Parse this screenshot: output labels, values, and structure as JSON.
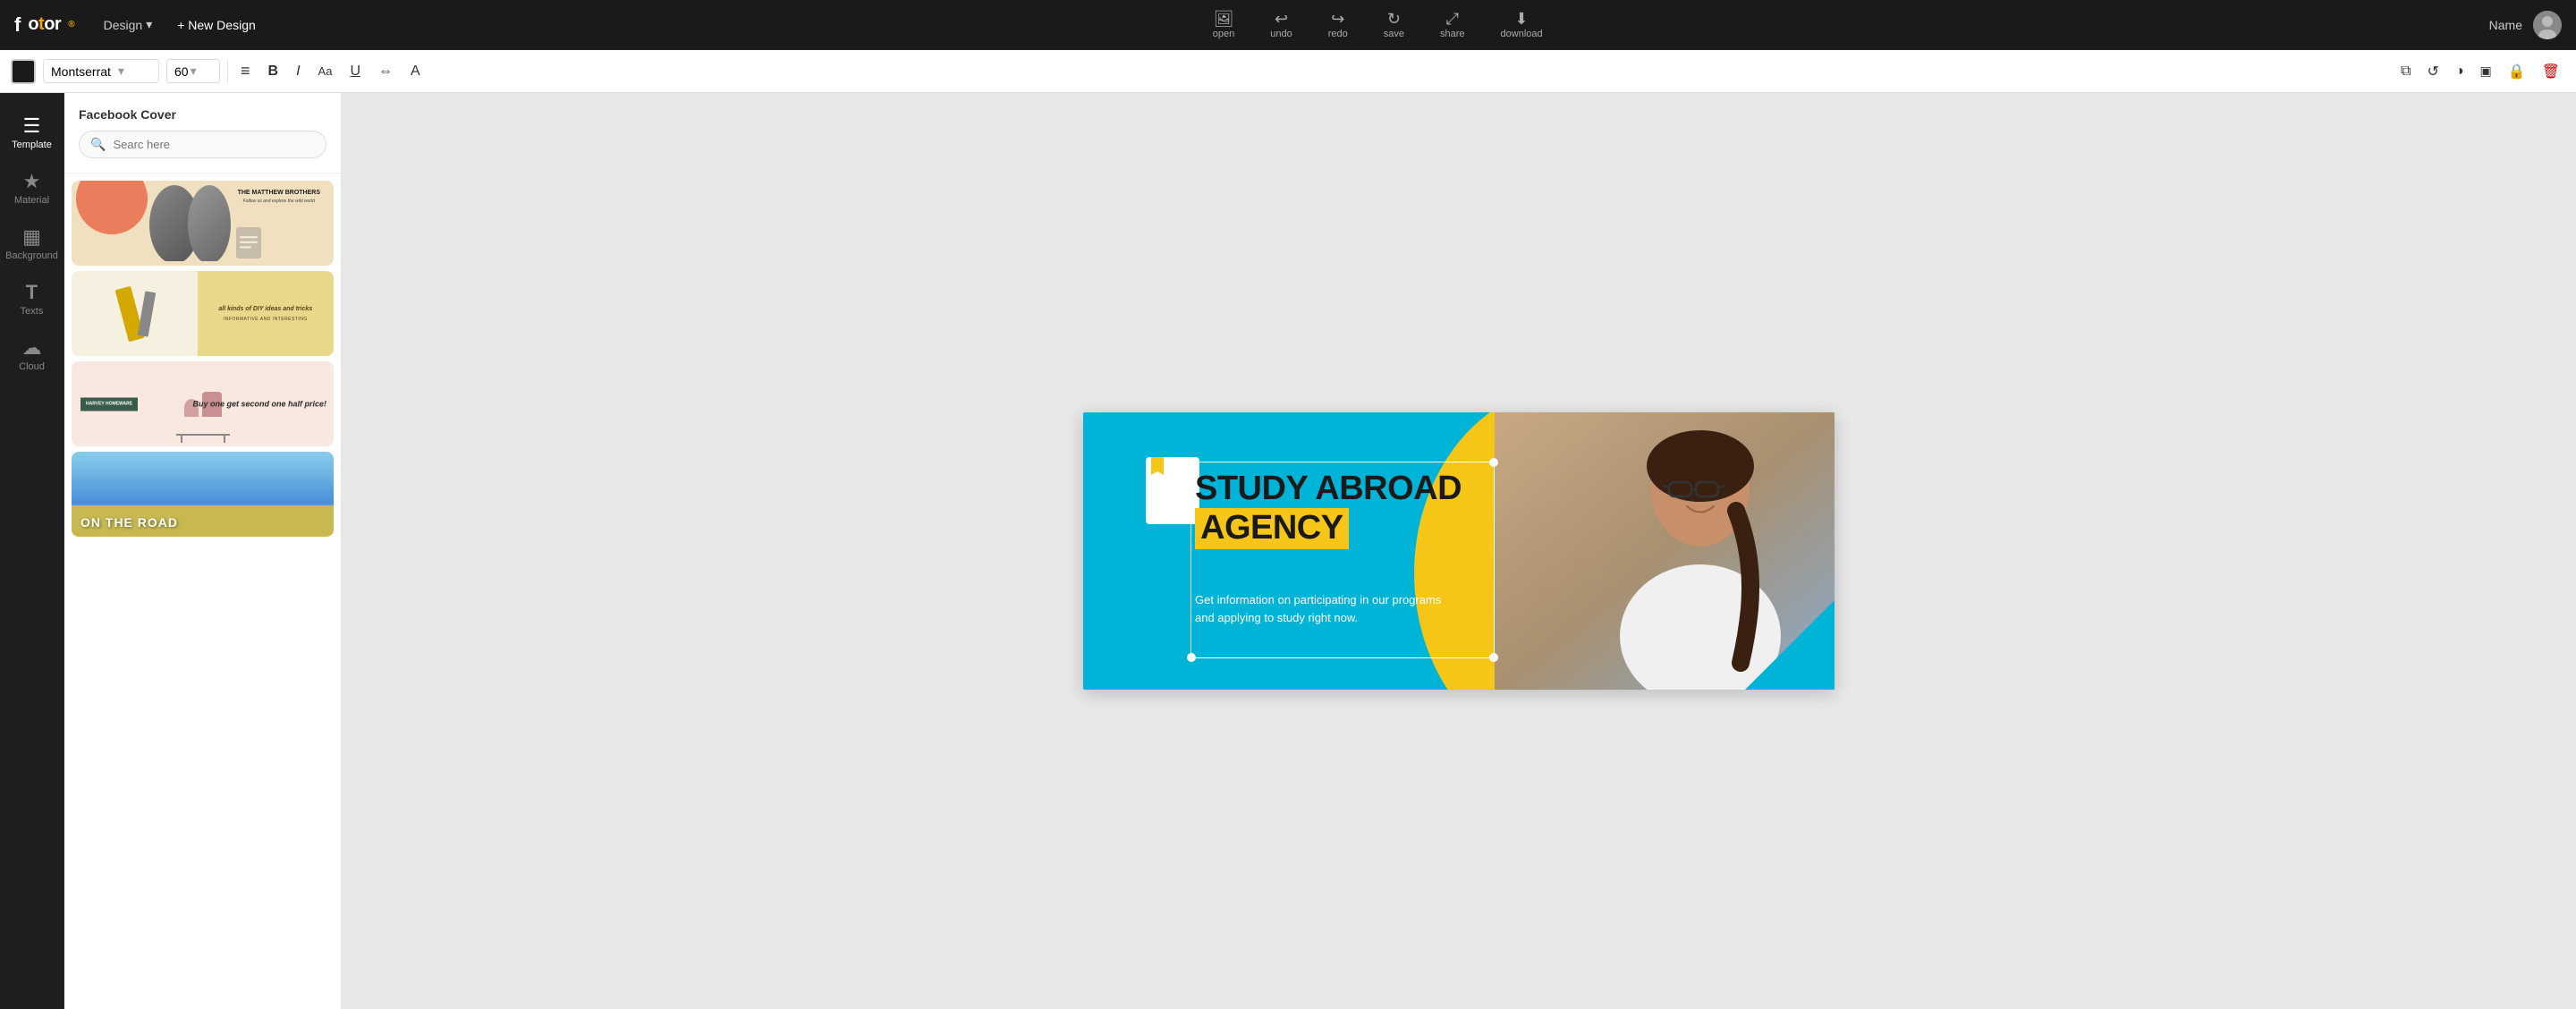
{
  "app": {
    "name": "fotor",
    "logo_symbol": "◈"
  },
  "topbar": {
    "design_label": "Design",
    "new_design_label": "+ New Design",
    "tools": [
      {
        "id": "open",
        "label": "open",
        "icon": "⬜"
      },
      {
        "id": "undo",
        "label": "undo",
        "icon": "↩"
      },
      {
        "id": "redo",
        "label": "redo",
        "icon": "↪"
      },
      {
        "id": "save",
        "label": "save",
        "icon": "↻"
      },
      {
        "id": "share",
        "label": "share",
        "icon": "⤢"
      },
      {
        "id": "download",
        "label": "download",
        "icon": "⬇"
      }
    ],
    "user_name": "Name"
  },
  "toolbar": {
    "font_name": "Montserrat",
    "font_size": "60",
    "buttons": [
      {
        "id": "align",
        "icon": "≡",
        "label": "align"
      },
      {
        "id": "bold",
        "icon": "B",
        "label": "bold"
      },
      {
        "id": "italic",
        "icon": "I",
        "label": "italic"
      },
      {
        "id": "font-size-aa",
        "icon": "Aa",
        "label": "font size"
      },
      {
        "id": "underline",
        "icon": "U",
        "label": "underline"
      },
      {
        "id": "spacing",
        "icon": "⇔",
        "label": "spacing"
      },
      {
        "id": "font-case",
        "icon": "A",
        "label": "font case"
      }
    ],
    "right_buttons": [
      {
        "id": "duplicate",
        "icon": "⧉",
        "label": "duplicate"
      },
      {
        "id": "rotate",
        "icon": "↺",
        "label": "rotate"
      },
      {
        "id": "mask",
        "icon": "◑",
        "label": "mask"
      },
      {
        "id": "layers",
        "icon": "⬛",
        "label": "layers"
      },
      {
        "id": "lock",
        "icon": "🔒",
        "label": "lock"
      },
      {
        "id": "delete",
        "icon": "🗑",
        "label": "delete"
      }
    ]
  },
  "sidebar": {
    "items": [
      {
        "id": "template",
        "label": "Template",
        "icon": "☰",
        "active": true
      },
      {
        "id": "material",
        "label": "Material",
        "icon": "★"
      },
      {
        "id": "background",
        "label": "Background",
        "icon": "▦"
      },
      {
        "id": "texts",
        "label": "Texts",
        "icon": "T"
      },
      {
        "id": "cloud",
        "label": "Cloud",
        "icon": "☁"
      }
    ]
  },
  "panel": {
    "title": "Facebook Cover",
    "search_placeholder": "Searc here",
    "templates": [
      {
        "id": "matthew-brothers",
        "title": "THE MATTHEW BROTHERS",
        "subtitle": "Follow us and explore the wild world"
      },
      {
        "id": "diy",
        "title": "all kinds of DIY ideas and tricks",
        "subtitle": "INFORMATIVE AND INTERESTING"
      },
      {
        "id": "harvey",
        "title": "Buy one get second one half price!",
        "brand": "HARVEY HOMEWARE"
      },
      {
        "id": "on-the-road",
        "title": "ON THE ROAD"
      }
    ]
  },
  "canvas": {
    "design_title_line1": "STUDY ABROAD",
    "design_title_line2": "AGENCY",
    "design_subtitle": "Get information on participating in our programs and applying to study right now.",
    "colors": {
      "bg": "#00b4d8",
      "accent": "#f5c518",
      "text_dark": "#1a1a1a",
      "text_light": "#ffffff"
    }
  }
}
